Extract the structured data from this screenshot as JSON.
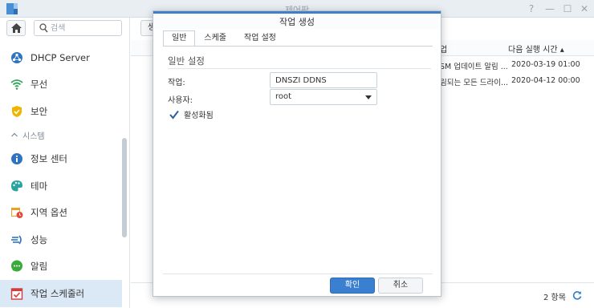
{
  "window": {
    "title": "제어판",
    "controls": [
      "?",
      "—",
      "☐",
      "✕"
    ]
  },
  "sidebar": {
    "search_placeholder": "검색",
    "items_top": [
      {
        "label": "DHCP Server",
        "icon": "dhcp-icon"
      },
      {
        "label": "무선",
        "icon": "wifi-icon"
      },
      {
        "label": "보안",
        "icon": "shield-icon"
      }
    ],
    "section_label": "시스템",
    "items_system": [
      {
        "label": "정보 센터",
        "icon": "info-icon"
      },
      {
        "label": "테마",
        "icon": "palette-icon"
      },
      {
        "label": "지역 옵션",
        "icon": "calendar-clock-icon"
      },
      {
        "label": "성능",
        "icon": "performance-icon"
      },
      {
        "label": "알림",
        "icon": "chat-icon"
      },
      {
        "label": "작업 스케줄러",
        "icon": "task-scheduler-icon",
        "active": true
      }
    ]
  },
  "main": {
    "create_button_peek": "생",
    "columns": {
      "action_partial": "업",
      "next_run": "다음 실행 시간 ▴"
    },
    "rows": [
      {
        "action": "SM 업데이트 알림 ...",
        "next_run": "2020-03-19 01:00"
      },
      {
        "action": "림되는 모든 드라이...",
        "next_run": "2020-04-12 00:00"
      }
    ],
    "item_count": "2 항목"
  },
  "dialog": {
    "title": "작업 생성",
    "tabs": [
      "일반",
      "스케줄",
      "작업 설정"
    ],
    "section_title": "일반 설정",
    "task_label": "작업:",
    "task_value": "DNSZI DDNS",
    "user_label": "사용자:",
    "user_value": "root",
    "enabled_label": "활성화됨",
    "ok_label": "확인",
    "cancel_label": "취소"
  },
  "colors": {
    "accent": "#3a7fd0",
    "active_row": "#dbe9f7"
  }
}
